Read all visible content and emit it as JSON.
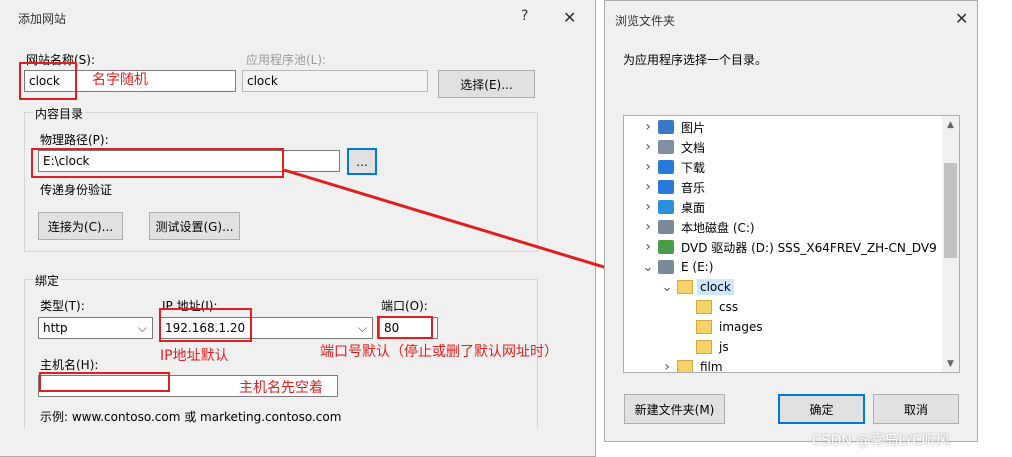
{
  "add_site": {
    "title": "添加网站",
    "help_glyph": "?",
    "close_glyph": "✕",
    "site_name_label": "网站名称(S):",
    "site_name_value": "clock",
    "app_pool_label": "应用程序池(L):",
    "app_pool_value": "clock",
    "select_button": "选择(E)...",
    "content_dir_group": "内容目录",
    "physical_path_label": "物理路径(P):",
    "physical_path_value": "E:\\clock",
    "browse_button": "...",
    "pass_through_auth": "传递身份验证",
    "connect_as_button": "连接为(C)...",
    "test_settings_button": "测试设置(G)...",
    "binding_group": "绑定",
    "type_label": "类型(T):",
    "type_value": "http",
    "ip_label": "IP 地址(I):",
    "ip_value": "192.168.1.20",
    "port_label": "端口(O):",
    "port_value": "80",
    "hostname_label": "主机名(H):",
    "hostname_value": "",
    "example_text": "示例: www.contoso.com 或 marketing.contoso.com"
  },
  "annotations": {
    "name_random": "名字随机",
    "ip_default": "IP地址默认",
    "port_default": "端口号默认（停止或删了默认网址时）",
    "hostname_empty": "主机名先空着",
    "color": "#e02020"
  },
  "browse_dialog": {
    "title": "浏览文件夹",
    "close_glyph": "✕",
    "prompt": "为应用程序选择一个目录。",
    "tree": [
      {
        "label": "图片",
        "icon": "pictures-icon",
        "level": 1,
        "expander": "collapsed"
      },
      {
        "label": "文档",
        "icon": "documents-icon",
        "level": 1,
        "expander": "collapsed"
      },
      {
        "label": "下载",
        "icon": "downloads-icon",
        "level": 1,
        "expander": "collapsed"
      },
      {
        "label": "音乐",
        "icon": "music-icon",
        "level": 1,
        "expander": "collapsed"
      },
      {
        "label": "桌面",
        "icon": "desktop-icon",
        "level": 1,
        "expander": "collapsed"
      },
      {
        "label": "本地磁盘 (C:)",
        "icon": "drive-icon",
        "level": 1,
        "expander": "collapsed"
      },
      {
        "label": "DVD 驱动器 (D:) SSS_X64FREV_ZH-CN_DV9",
        "icon": "dvd-icon",
        "level": 1,
        "expander": "collapsed"
      },
      {
        "label": "E (E:)",
        "icon": "drive-icon",
        "level": 1,
        "expander": "expanded"
      },
      {
        "label": "clock",
        "icon": "folder-icon",
        "level": 2,
        "expander": "expanded",
        "selected": true
      },
      {
        "label": "css",
        "icon": "folder-icon",
        "level": 3,
        "expander": "none"
      },
      {
        "label": "images",
        "icon": "folder-icon",
        "level": 3,
        "expander": "none"
      },
      {
        "label": "js",
        "icon": "folder-icon",
        "level": 3,
        "expander": "none"
      },
      {
        "label": "film",
        "icon": "folder-icon",
        "level": 2,
        "expander": "collapsed"
      }
    ],
    "new_folder_button": "新建文件夹(M)",
    "ok_button": "确定",
    "cancel_button": "取消"
  },
  "watermark": "CSDN @雾岛LYC听风"
}
